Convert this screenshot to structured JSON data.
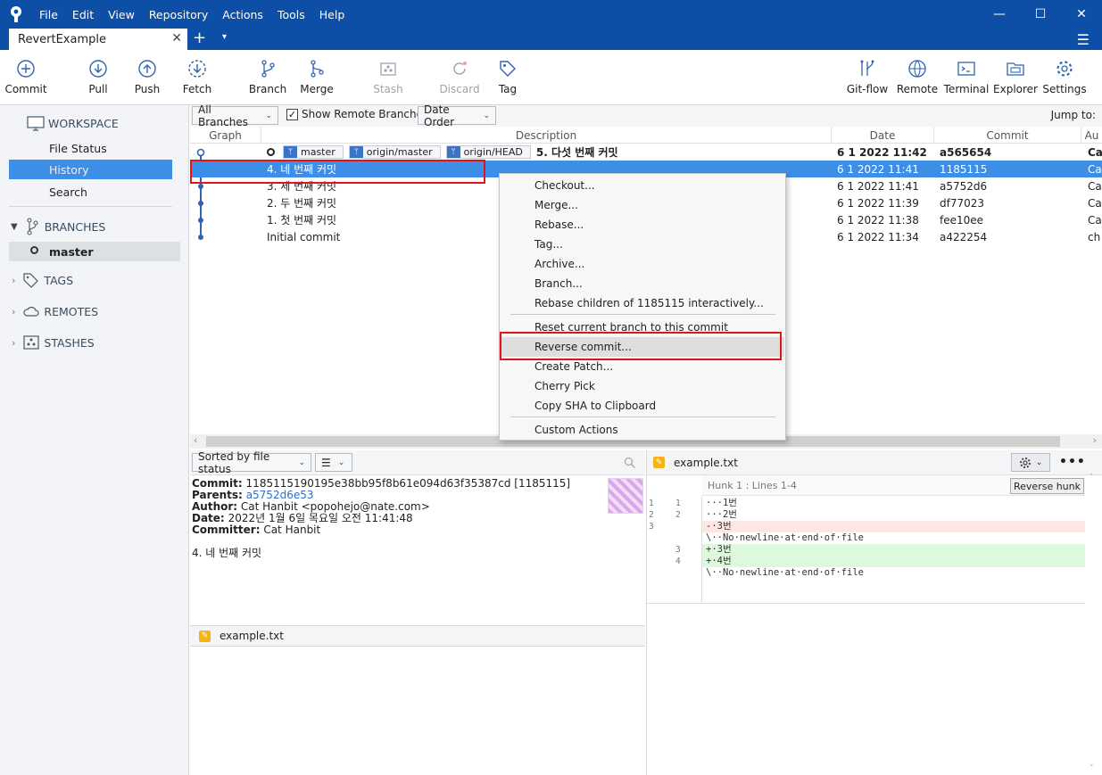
{
  "menu": [
    "File",
    "Edit",
    "View",
    "Repository",
    "Actions",
    "Tools",
    "Help"
  ],
  "tab": {
    "title": "RevertExample",
    "close": "✕",
    "add": "+",
    "dropdown": "▾",
    "menu": "☰"
  },
  "window": {
    "minimize": "—",
    "maximize": "☐",
    "close": "✕"
  },
  "toolbar": {
    "commit": "Commit",
    "pull": "Pull",
    "push": "Push",
    "fetch": "Fetch",
    "branch": "Branch",
    "merge": "Merge",
    "stash": "Stash",
    "discard": "Discard",
    "tag": "Tag",
    "gitflow": "Git-flow",
    "remote": "Remote",
    "terminal": "Terminal",
    "explorer": "Explorer",
    "settings": "Settings"
  },
  "sidebar": {
    "workspace": "WORKSPACE",
    "workspace_items": [
      "File Status",
      "History",
      "Search"
    ],
    "branches": "BRANCHES",
    "branch_items": [
      "master"
    ],
    "tags": "TAGS",
    "remotes": "REMOTES",
    "stashes": "STASHES"
  },
  "filter": {
    "branches": "All Branches",
    "show_remote": "Show Remote Branches",
    "order": "Date Order",
    "jump_to": "Jump to:"
  },
  "columns": {
    "graph": "Graph",
    "description": "Description",
    "date": "Date",
    "commit": "Commit",
    "author": "Au"
  },
  "commits": [
    {
      "tags": [
        "master",
        "origin/master",
        "origin/HEAD"
      ],
      "message": "5. 다섯 번째 커밋",
      "date": "6 1 2022 11:42",
      "hash": "a565654",
      "author": "Ca"
    },
    {
      "tags": [],
      "message": "4. 네 번째 커밋",
      "date": "6 1 2022 11:41",
      "hash": "1185115",
      "author": "Ca"
    },
    {
      "tags": [],
      "message": "3. 세 번째 커밋",
      "date": "6 1 2022 11:41",
      "hash": "a5752d6",
      "author": "Ca"
    },
    {
      "tags": [],
      "message": "2. 두 번째 커밋",
      "date": "6 1 2022 11:39",
      "hash": "df77023",
      "author": "Ca"
    },
    {
      "tags": [],
      "message": "1. 첫 번째 커밋",
      "date": "6 1 2022 11:38",
      "hash": "fee10ee",
      "author": "Ca"
    },
    {
      "tags": [],
      "message": "Initial commit",
      "date": "6 1 2022 11:34",
      "hash": "a422254",
      "author": "ch"
    }
  ],
  "context_menu": [
    "Checkout...",
    "Merge...",
    "Rebase...",
    "Tag...",
    "Archive...",
    "Branch...",
    "Rebase children of 1185115 interactively...",
    "Reset current branch to this commit",
    "Reverse commit...",
    "Create Patch...",
    "Cherry Pick",
    "Copy SHA to Clipboard",
    "Custom Actions"
  ],
  "bottom_left": {
    "sort": "Sorted by file status",
    "view_mode": "☰",
    "commit_label": "Commit:",
    "commit_value": "1185115190195e38bb95f8b61e094d63f35387cd [1185115]",
    "parents_label": "Parents:",
    "parents_value": "a5752d6e53",
    "author_label": "Author:",
    "author_value": "Cat Hanbit <popohejo@nate.com>",
    "date_label": "Date:",
    "date_value": "2022년 1월 6일 목요일 오전 11:41:48",
    "committer_label": "Committer:",
    "committer_value": "Cat Hanbit",
    "message": "4. 네 번째 커밋",
    "file": "example.txt"
  },
  "diff": {
    "file": "example.txt",
    "hunk": "Hunk 1 : Lines 1-4",
    "reverse_hunk": "Reverse hunk",
    "lines": [
      {
        "type": "ctx",
        "old": "1",
        "new": "1",
        "text": "···1번"
      },
      {
        "type": "ctx",
        "old": "2",
        "new": "2",
        "text": "···2번"
      },
      {
        "type": "del",
        "old": "3",
        "new": "",
        "text": "-·3번"
      },
      {
        "type": "ctx",
        "old": "",
        "new": "",
        "text": "\\··No·newline·at·end·of·file"
      },
      {
        "type": "add",
        "old": "",
        "new": "3",
        "text": "+·3번"
      },
      {
        "type": "add",
        "old": "",
        "new": "4",
        "text": "+·4번"
      },
      {
        "type": "ctx",
        "old": "",
        "new": "",
        "text": "\\··No·newline·at·end·of·file"
      }
    ]
  },
  "colors": {
    "titlebar": "#0d4fa6",
    "selection": "#3d8ee6",
    "highlight": "#e0141b",
    "graph": "#2f64b0"
  }
}
